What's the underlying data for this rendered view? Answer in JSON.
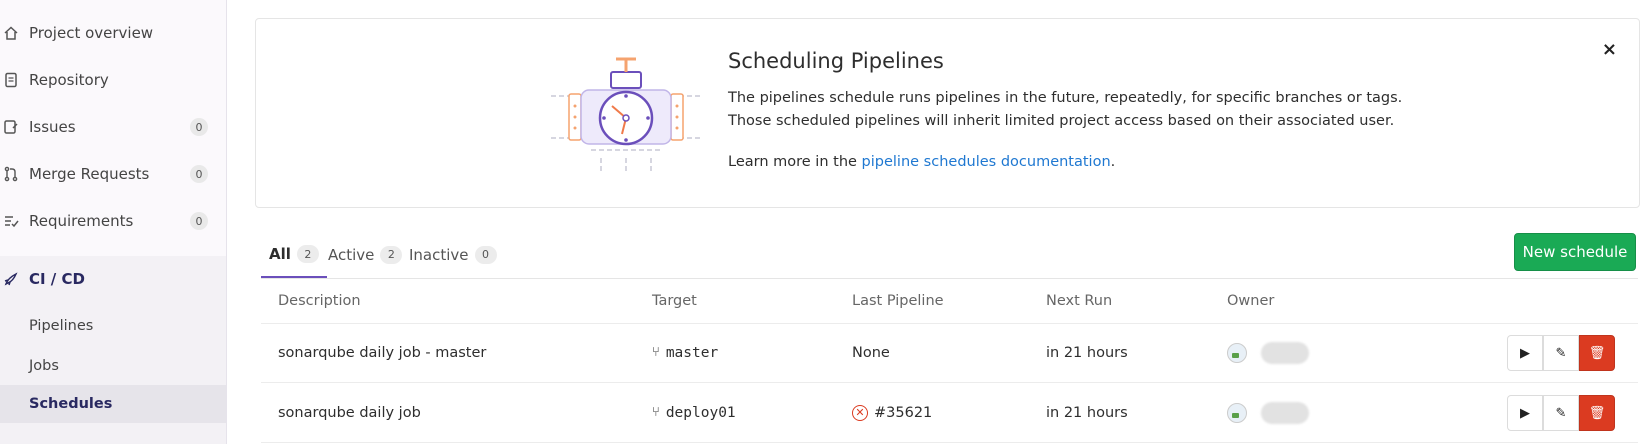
{
  "sidebar": {
    "items": [
      {
        "label": "Project overview",
        "icon": "home-icon"
      },
      {
        "label": "Repository",
        "icon": "doc-icon"
      },
      {
        "label": "Issues",
        "icon": "issues-icon",
        "count": "0"
      },
      {
        "label": "Merge Requests",
        "icon": "merge-request-icon",
        "count": "0"
      },
      {
        "label": "Requirements",
        "icon": "requirements-icon",
        "count": "0"
      },
      {
        "label": "CI / CD",
        "icon": "rocket-icon"
      }
    ],
    "sub_items": [
      {
        "label": "Pipelines"
      },
      {
        "label": "Jobs"
      },
      {
        "label": "Schedules"
      }
    ]
  },
  "callout": {
    "title": "Scheduling Pipelines",
    "desc_line1": "The pipelines schedule runs pipelines in the future, repeatedly, for specific branches or tags.",
    "desc_line2": "Those scheduled pipelines will inherit limited project access based on their associated user.",
    "learn_prefix": "Learn more in the ",
    "learn_link": "pipeline schedules documentation",
    "learn_suffix": ".",
    "close": "×"
  },
  "tabs": [
    {
      "label": "All",
      "count": "2"
    },
    {
      "label": "Active",
      "count": "2"
    },
    {
      "label": "Inactive",
      "count": "0"
    }
  ],
  "new_schedule_label": "New schedule",
  "table": {
    "headers": [
      "Description",
      "Target",
      "Last Pipeline",
      "Next Run",
      "Owner"
    ],
    "rows": [
      {
        "description": "sonarqube daily job - master",
        "target": "master",
        "last_pipeline": "None",
        "next_run": "in 21 hours"
      },
      {
        "description": "sonarqube daily job",
        "target": "deploy01",
        "last_pipeline": "#35621",
        "next_run": "in 21 hours"
      }
    ]
  },
  "colors": {
    "accent": "#6b4fbb",
    "success": "#1aaa55",
    "danger": "#db3b21",
    "link": "#1f78d1"
  }
}
